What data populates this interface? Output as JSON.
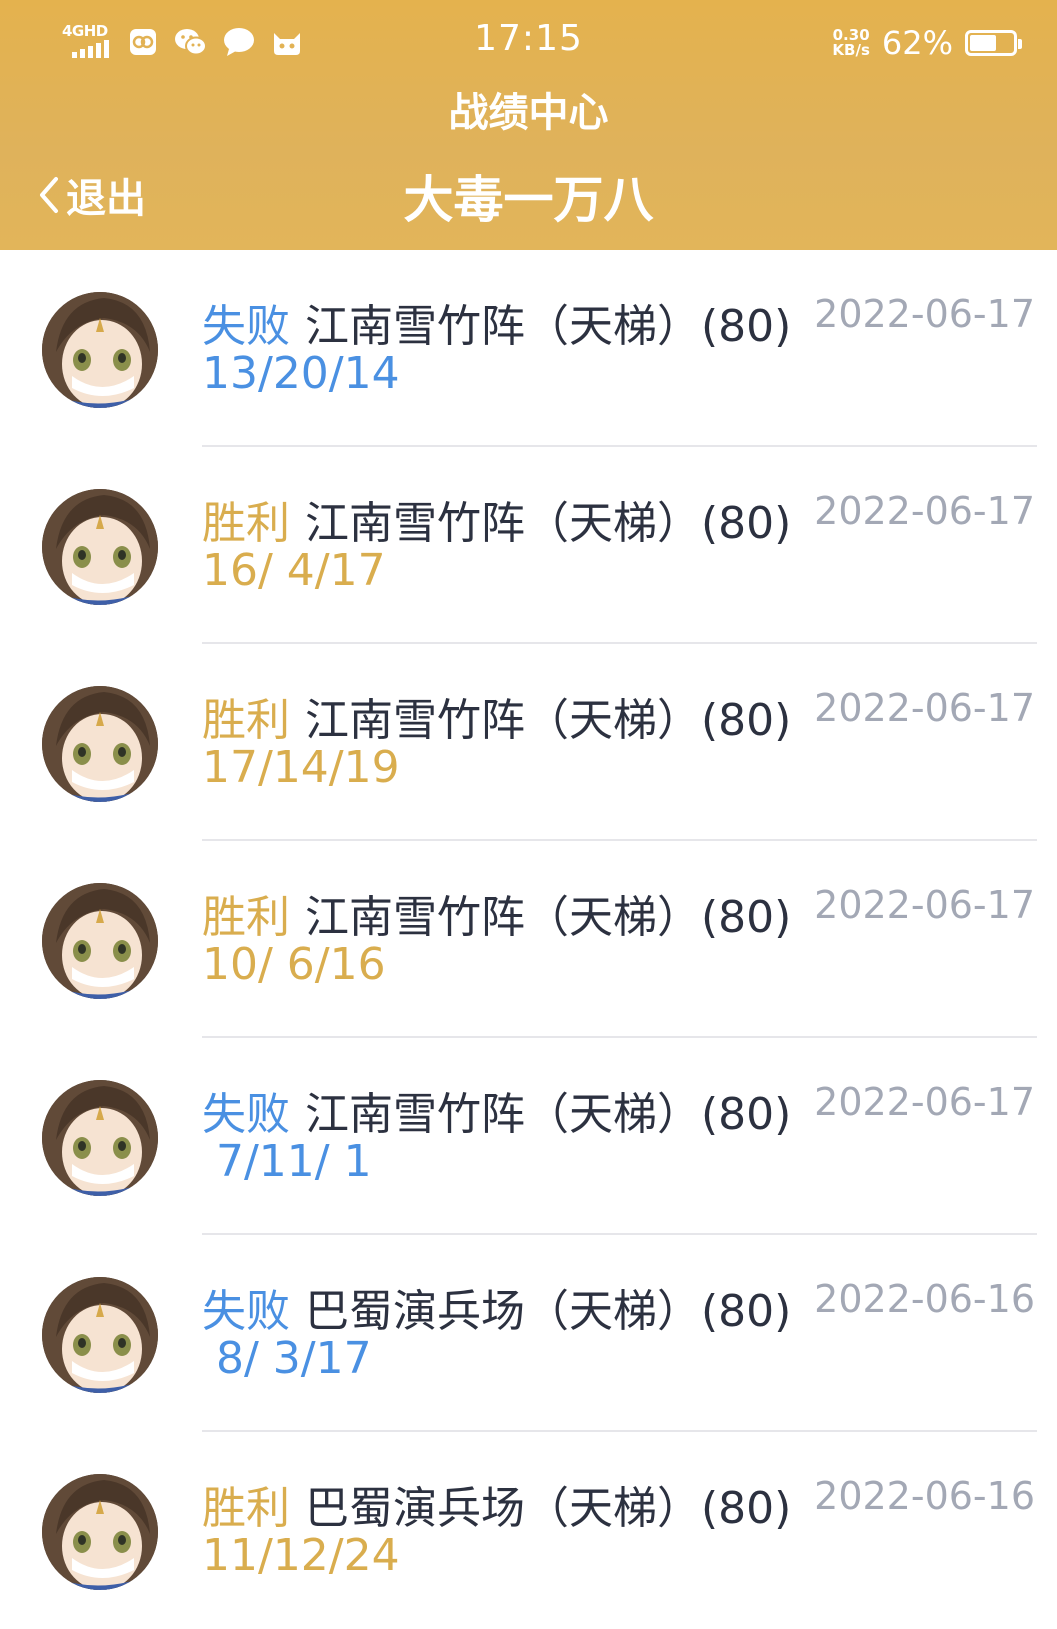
{
  "status_bar": {
    "network": "4GHD",
    "time": "17:15",
    "speed_value": "0.30",
    "speed_unit": "KB/s",
    "battery_percent": "62%",
    "battery_level": 0.62,
    "icons": [
      "signal-icon",
      "gallery-icon",
      "wechat-icon",
      "message-icon",
      "cat-icon"
    ]
  },
  "header": {
    "app_title": "战绩中心",
    "back_label": "退出",
    "player_name": "大毒一万八"
  },
  "colors": {
    "header_bg": "#e2b254",
    "lose": "#4a90e2",
    "win": "#d9ad4e",
    "map_text": "#2c3140",
    "date_text": "#a3a8b5"
  },
  "matches": [
    {
      "result": "失败",
      "outcome": "lose",
      "map": "江南雪竹阵（天梯）(80)",
      "kda": "13/20/14",
      "date": "2022-06-17"
    },
    {
      "result": "胜利",
      "outcome": "win",
      "map": "江南雪竹阵（天梯）(80)",
      "kda": "16/ 4/17",
      "date": "2022-06-17"
    },
    {
      "result": "胜利",
      "outcome": "win",
      "map": "江南雪竹阵（天梯）(80)",
      "kda": "17/14/19",
      "date": "2022-06-17"
    },
    {
      "result": "胜利",
      "outcome": "win",
      "map": "江南雪竹阵（天梯）(80)",
      "kda": "10/ 6/16",
      "date": "2022-06-17"
    },
    {
      "result": "失败",
      "outcome": "lose",
      "map": "江南雪竹阵（天梯）(80)",
      "kda": " 7/11/ 1",
      "date": "2022-06-17"
    },
    {
      "result": "失败",
      "outcome": "lose",
      "map": "巴蜀演兵场（天梯）(80)",
      "kda": " 8/ 3/17",
      "date": "2022-06-16"
    },
    {
      "result": "胜利",
      "outcome": "win",
      "map": "巴蜀演兵场（天梯）(80)",
      "kda": "11/12/24",
      "date": "2022-06-16"
    }
  ]
}
